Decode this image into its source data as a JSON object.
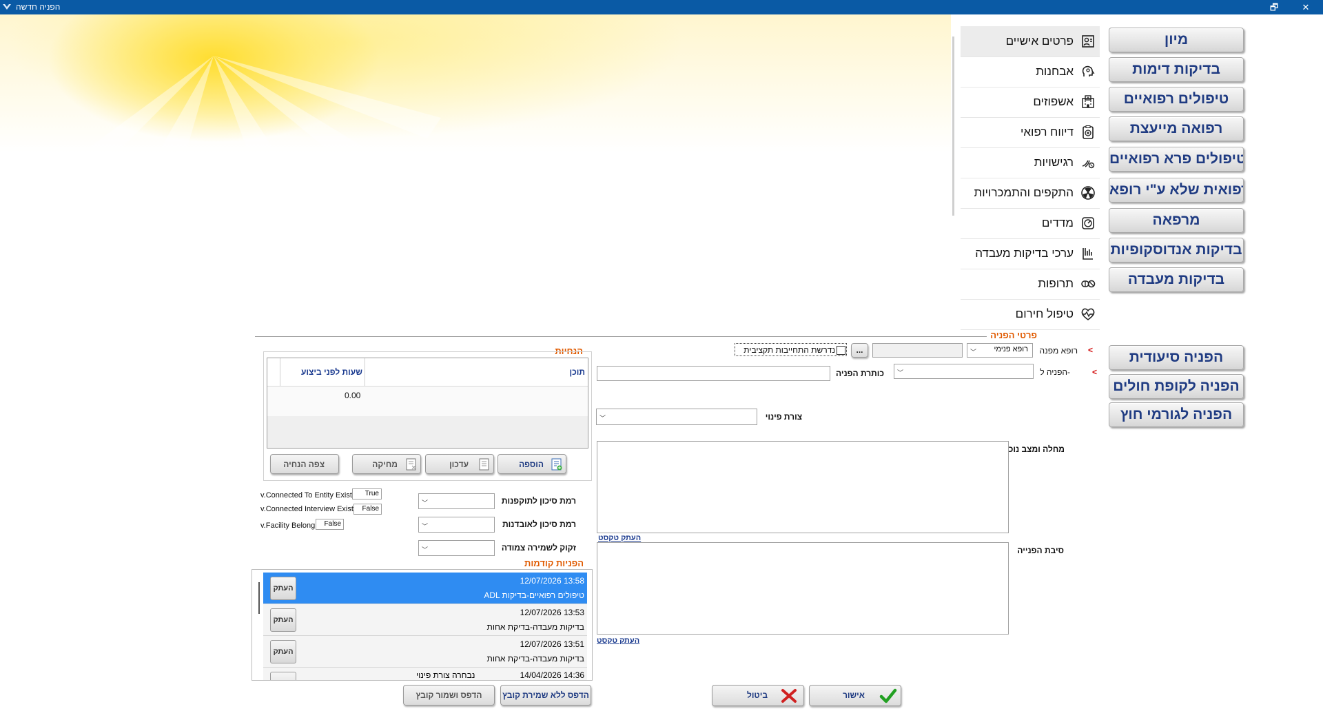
{
  "window": {
    "title": "הפניה חדשה",
    "restore_glyph": "🗗",
    "close_glyph": "✕"
  },
  "categories": [
    "מיון",
    "בדיקות דימות",
    "טיפולים רפואיים",
    "רפואה מייעצת",
    "טיפולים פרא רפואיים",
    "בדיקה רפואית שלא ע\"י רופא",
    "מרפאה",
    "בדיקות אנדוסקופיות",
    "בדיקות מעבדה"
  ],
  "referral_types": [
    "הפניה סיעודית",
    "הפניה לקופת חולים",
    "הפניה לגורמי חוץ"
  ],
  "side_menu": [
    {
      "label": "פרטים אישיים",
      "icon": "personal-details-icon"
    },
    {
      "label": "אבחנות",
      "icon": "diagnosis-head-icon"
    },
    {
      "label": "אשפוזים",
      "icon": "hospital-icon"
    },
    {
      "label": "דיווח רפואי",
      "icon": "medical-report-icon"
    },
    {
      "label": "רגישויות",
      "icon": "allergy-icon"
    },
    {
      "label": "התקפים והתמכרויות",
      "icon": "radiation-icon"
    },
    {
      "label": "מדדים",
      "icon": "vitals-icon"
    },
    {
      "label": "ערכי בדיקות מעבדה",
      "icon": "lab-values-icon"
    },
    {
      "label": "תרופות",
      "icon": "pills-icon"
    },
    {
      "label": "טיפול חירום",
      "icon": "heartbeat-icon"
    }
  ],
  "form": {
    "section_title": "פרטי הפניה",
    "referring_doctor_label": "רופא מפנה",
    "referring_doctor_value": "רופא פנימי",
    "referring_doctor_code": "",
    "browse_label": "...",
    "periodic_commitment_label": "נדרשת התחייבות תקציבית",
    "referral_to_label": "הפניה ל-",
    "referral_to_value": "",
    "referral_title_label": "כותרת הפניה",
    "referral_title_value": "",
    "evacuation_label": "צורת פינוי",
    "evacuation_value": "",
    "current_condition_label": "מחלה ומצב נוכחיים",
    "referral_reason_label": "סיבת הפנייה",
    "copy_text_label": "העתק טקסט"
  },
  "instructions": {
    "title": "הנחיות",
    "col_content": "תוכן",
    "col_hours": "שעות לפני ביצוע",
    "row_hours": "0.00",
    "add": "הוספה",
    "update": "עדכון",
    "delete": "מחיקה",
    "view": "צפה הנחיה"
  },
  "risk": {
    "validity_label": "רמת סיכון לתוקפנות",
    "loss_label": "רמת סיכון לאובדנות",
    "close_guard_label": "זקוק לשמירה צמודה",
    "entity_label": "v.Connected To Entity Exist",
    "entity_value": "True",
    "interview_label": "v.Connected Interview Exist",
    "interview_value": "False",
    "facility_label": "v.Facility Belong",
    "facility_value": "False"
  },
  "previous": {
    "title": "הפניות קודמות",
    "copy_label": "העתק",
    "rows": [
      {
        "date": "12/07/2026 13:58",
        "subject": "ADL טיפולים רפואיים-בדיקות"
      },
      {
        "date": "12/07/2026 13:53",
        "subject": "בדיקות מעבדה-בדיקת אחות"
      },
      {
        "date": "12/07/2026 13:51",
        "subject": "בדיקות מעבדה-בדיקת אחות"
      },
      {
        "date": "14/04/2026 14:36",
        "subject": "נבחרה צורת פינוי"
      }
    ]
  },
  "footer": {
    "print_save": "הדפס ושמור קובץ",
    "print_no_save": "הדפס ללא שמירת קובץ",
    "cancel": "ביטול",
    "ok": "אישור"
  },
  "colors": {
    "accent": "#e05a00",
    "titlebar": "#0a5aa5",
    "selection": "#2f8cf2",
    "button_text": "#1f3b82"
  }
}
